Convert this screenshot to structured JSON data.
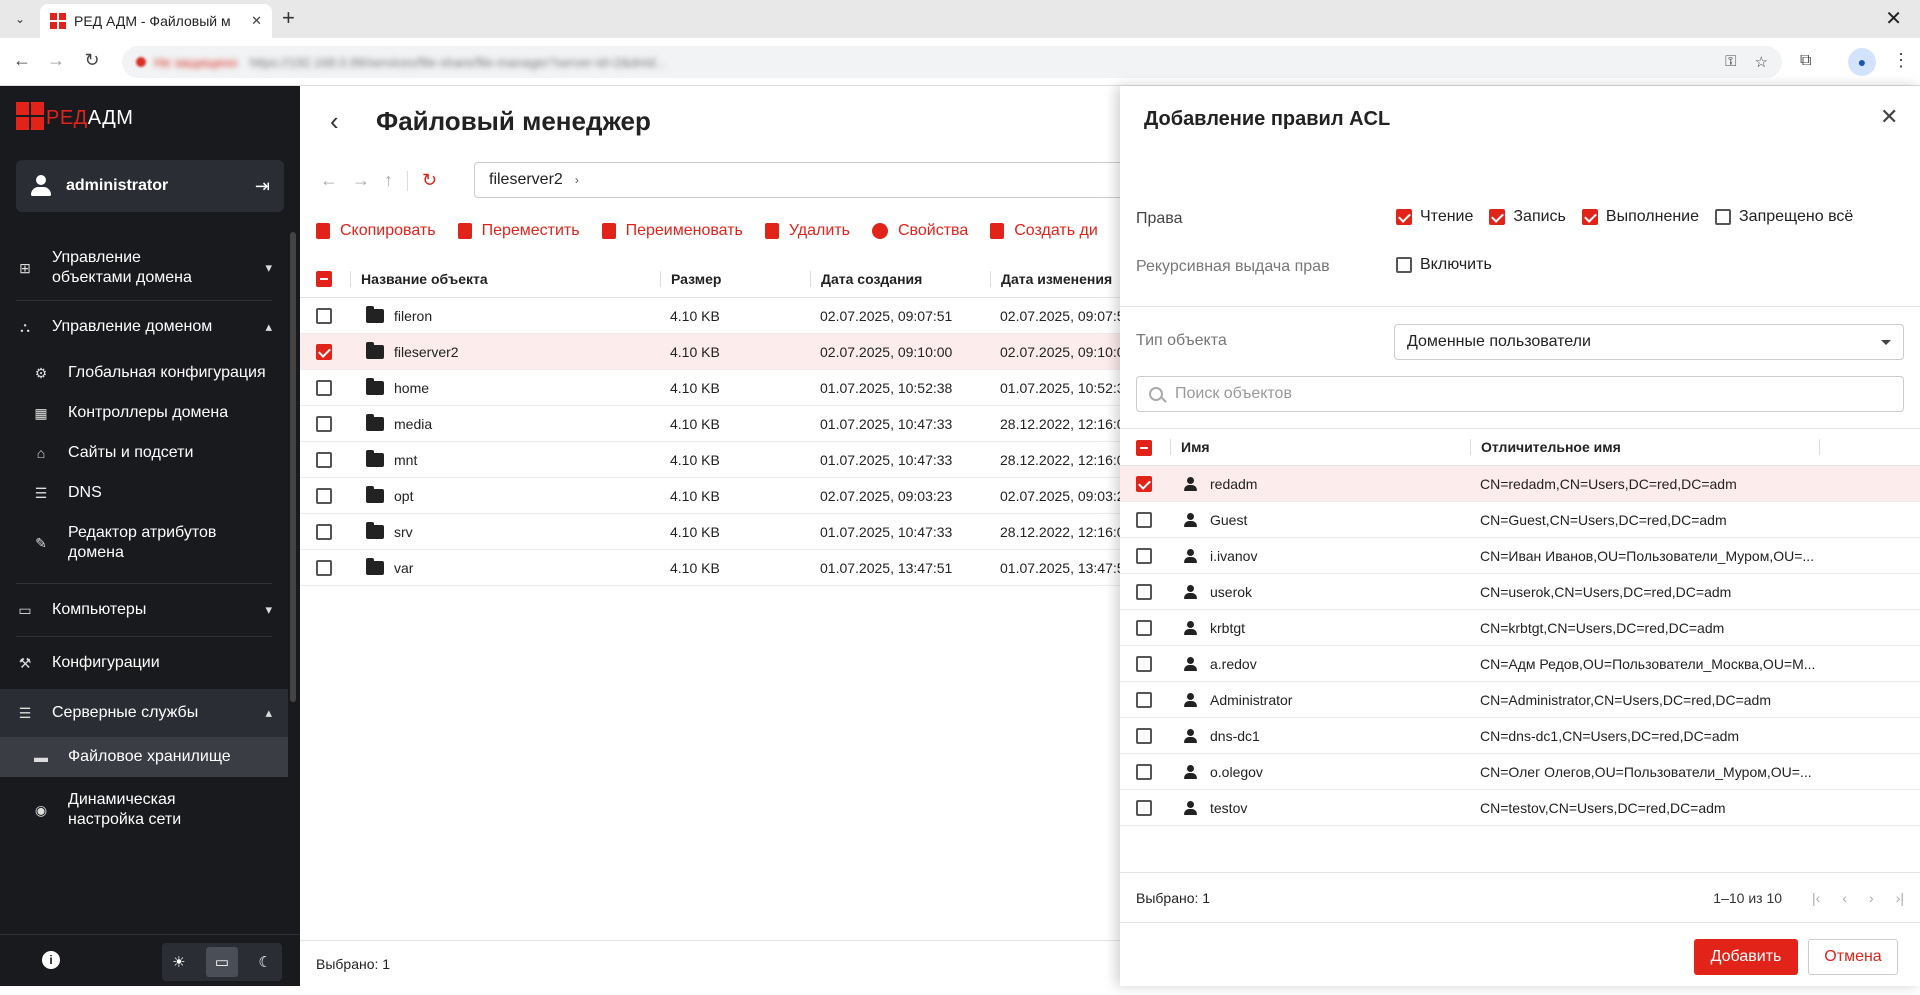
{
  "browser": {
    "tab_title": "РЕД АДМ - Файловый м",
    "url_warning": "Не защищено",
    "url": "https://192.168.0.99/services/file-share/file-manager?server-id=2&dnId...",
    "icons": [
      "key-icon",
      "star-icon",
      "extension-icon",
      "profile-icon",
      "kebab-menu-icon"
    ]
  },
  "sidebar": {
    "logo_red": "РЕД",
    "logo_rest": "АДМ",
    "user": "administrator",
    "items": [
      {
        "label": "Управление объектами домена",
        "icon": "domain-objects-icon"
      },
      {
        "label": "Управление доменом",
        "icon": "domain-icon"
      },
      {
        "label": "Глобальная конфигурация",
        "icon": "gear-icon"
      },
      {
        "label": "Контроллеры домена",
        "icon": "building-icon"
      },
      {
        "label": "Сайты и подсети",
        "icon": "sites-icon"
      },
      {
        "label": "DNS",
        "icon": "dns-icon"
      },
      {
        "label": "Редактор атрибутов домена",
        "icon": "edit-attributes-icon"
      },
      {
        "label": "Компьютеры",
        "icon": "computer-icon"
      },
      {
        "label": "Конфигурации",
        "icon": "config-icon"
      },
      {
        "label": "Серверные службы",
        "icon": "server-services-icon"
      },
      {
        "label": "Файловое хранилище",
        "icon": "folder-icon"
      },
      {
        "label": "Динамическая настройка сети",
        "icon": "network-icon"
      }
    ]
  },
  "main": {
    "title": "Файловый менеджер",
    "path": "fileserver2",
    "toolbar": [
      "Скопировать",
      "Переместить",
      "Переименовать",
      "Удалить",
      "Свойства",
      "Создать ди"
    ],
    "columns": [
      "Название объекта",
      "Размер",
      "Дата создания",
      "Дата изменения"
    ],
    "rows": [
      {
        "name": "fileron",
        "size": "4.10 KB",
        "created": "02.07.2025, 09:07:51",
        "modified": "02.07.2025, 09:07:5",
        "checked": false
      },
      {
        "name": "fileserver2",
        "size": "4.10 KB",
        "created": "02.07.2025, 09:10:00",
        "modified": "02.07.2025, 09:10:0",
        "checked": true
      },
      {
        "name": "home",
        "size": "4.10 KB",
        "created": "01.07.2025, 10:52:38",
        "modified": "01.07.2025, 10:52:3",
        "checked": false
      },
      {
        "name": "media",
        "size": "4.10 KB",
        "created": "01.07.2025, 10:47:33",
        "modified": "28.12.2022, 12:16:0",
        "checked": false
      },
      {
        "name": "mnt",
        "size": "4.10 KB",
        "created": "01.07.2025, 10:47:33",
        "modified": "28.12.2022, 12:16:0",
        "checked": false
      },
      {
        "name": "opt",
        "size": "4.10 KB",
        "created": "02.07.2025, 09:03:23",
        "modified": "02.07.2025, 09:03:2",
        "checked": false
      },
      {
        "name": "srv",
        "size": "4.10 KB",
        "created": "01.07.2025, 10:47:33",
        "modified": "28.12.2022, 12:16:0",
        "checked": false
      },
      {
        "name": "var",
        "size": "4.10 KB",
        "created": "01.07.2025, 13:47:51",
        "modified": "01.07.2025, 13:47:5",
        "checked": false
      }
    ],
    "footer": "Выбрано: 1"
  },
  "drawer": {
    "title": "Добавление правил ACL",
    "rights_label": "Права",
    "rights": [
      {
        "label": "Чтение",
        "checked": true
      },
      {
        "label": "Запись",
        "checked": true
      },
      {
        "label": "Выполнение",
        "checked": true
      },
      {
        "label": "Запрещено всё",
        "checked": false
      }
    ],
    "recursive_label": "Рекурсивная выдача прав",
    "recursive_option": "Включить",
    "object_type_label": "Тип объекта",
    "object_type_value": "Доменные пользователи",
    "search_placeholder": "Поиск объектов",
    "columns": [
      "Имя",
      "Отличительное имя"
    ],
    "users": [
      {
        "name": "redadm",
        "dn": "CN=redadm,CN=Users,DC=red,DC=adm",
        "checked": true
      },
      {
        "name": "Guest",
        "dn": "CN=Guest,CN=Users,DC=red,DC=adm",
        "checked": false
      },
      {
        "name": "i.ivanov",
        "dn": "CN=Иван Иванов,OU=Пользователи_Муром,OU=...",
        "checked": false
      },
      {
        "name": "userok",
        "dn": "CN=userok,CN=Users,DC=red,DC=adm",
        "checked": false
      },
      {
        "name": "krbtgt",
        "dn": "CN=krbtgt,CN=Users,DC=red,DC=adm",
        "checked": false
      },
      {
        "name": "a.redov",
        "dn": "CN=Адм Редов,OU=Пользователи_Москва,OU=M...",
        "checked": false
      },
      {
        "name": "Administrator",
        "dn": "CN=Administrator,CN=Users,DC=red,DC=adm",
        "checked": false
      },
      {
        "name": "dns-dc1",
        "dn": "CN=dns-dc1,CN=Users,DC=red,DC=adm",
        "checked": false
      },
      {
        "name": "o.olegov",
        "dn": "CN=Олег Олегов,OU=Пользователи_Муром,OU=...",
        "checked": false
      },
      {
        "name": "testov",
        "dn": "CN=testov,CN=Users,DC=red,DC=adm",
        "checked": false
      }
    ],
    "selected": "Выбрано: 1",
    "pagination": "1–10 из 10",
    "add_button": "Добавить",
    "cancel_button": "Отмена"
  },
  "colors": {
    "accent": "#e2231a",
    "sidebar_bg": "#181a1e",
    "selected_row": "#fdecec"
  }
}
